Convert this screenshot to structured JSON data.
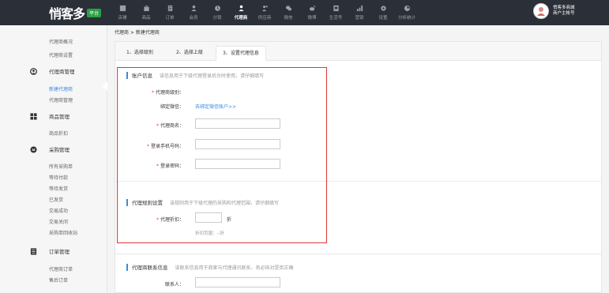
{
  "header": {
    "logo_text": "悄客多",
    "logo_badge": "平台",
    "nav": [
      {
        "label": "店铺",
        "icon": "store-icon",
        "active": false
      },
      {
        "label": "商品",
        "icon": "shopping-bag-icon",
        "active": false
      },
      {
        "label": "订单",
        "icon": "order-icon",
        "active": false
      },
      {
        "label": "会员",
        "icon": "member-icon",
        "active": false
      },
      {
        "label": "分销",
        "icon": "distribution-icon",
        "active": false
      },
      {
        "label": "代理商",
        "icon": "agent-icon",
        "active": true
      },
      {
        "label": "供应商",
        "icon": "supplier-icon",
        "active": false
      },
      {
        "label": "微信",
        "icon": "wechat-icon",
        "active": false
      },
      {
        "label": "微博",
        "icon": "weibo-icon",
        "active": false
      },
      {
        "label": "生活号",
        "icon": "life-icon",
        "active": false
      },
      {
        "label": "营销",
        "icon": "marketing-icon",
        "active": false
      },
      {
        "label": "设置",
        "icon": "settings-icon",
        "active": false
      },
      {
        "label": "分析统计",
        "icon": "analytics-icon",
        "active": false
      }
    ],
    "user_name": "悄客多商城",
    "user_role": "商户主帐号"
  },
  "sidebar": {
    "top_items": [
      "代理商概况",
      "代理商设置"
    ],
    "groups": [
      {
        "label": "代理商管理",
        "icon": "agent-manage-icon",
        "items": [
          "新建代理商",
          "代理商管理"
        ]
      },
      {
        "label": "商品管理",
        "icon": "grid-icon",
        "items": [
          "商品折扣"
        ]
      },
      {
        "label": "采购管理",
        "icon": "purchase-icon",
        "items": [
          "所有采购单",
          "等待付款",
          "等待发货",
          "已发货",
          "交易成功",
          "交易关闭",
          "采购单回收站"
        ]
      },
      {
        "label": "订单管理",
        "icon": "order-list-icon",
        "items": [
          "代理商订单",
          "售后订单"
        ]
      }
    ],
    "active_item": "新建代理商"
  },
  "breadcrumb": "代理商 > 新建代理商",
  "tabs": [
    "1、选择级别",
    "2、选择上级",
    "3、设置代理信息"
  ],
  "account_section": {
    "title": "账户信息",
    "desc": "该信息用于下级代理登录后台时使用，请仔细填写",
    "level_label": "代理商级别：",
    "wechat_label": "绑定微信：",
    "wechat_link": "去绑定微信账户>>",
    "name_label": "代理商名：",
    "phone_label": "登录手机号码：",
    "password_label": "登录密码："
  },
  "rule_section": {
    "title": "代理规则设置",
    "desc": "该规则用于下级代理的采购和代理范围，请仔细填写",
    "discount_label": "代理折扣：",
    "discount_unit": "折",
    "discount_hint": "折扣范围：--折"
  },
  "contact_section": {
    "title": "代理商联系信息",
    "desc": "该联系信息用于商家与代理通讯联系，务必核对是否正确",
    "contact_label": "联系人："
  },
  "required_mark": "*",
  "colors": {
    "accent": "#3a8be0",
    "topbar": "#2b2f38",
    "highlight_box": "#d9383a",
    "required": "#e5403a",
    "logo_badge": "#2aa046"
  }
}
